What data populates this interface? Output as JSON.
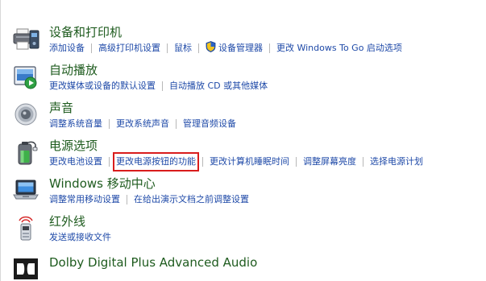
{
  "categories": [
    {
      "title": "设备和打印机",
      "icon": "printer-device-icon",
      "links": [
        "添加设备",
        "高级打印机设置",
        "鼠标",
        "设备管理器",
        "更改 Windows To Go 启动选项"
      ]
    },
    {
      "title": "自动播放",
      "icon": "autoplay-icon",
      "links": [
        "更改媒体或设备的默认设置",
        "自动播放 CD 或其他媒体"
      ]
    },
    {
      "title": "声音",
      "icon": "speaker-icon",
      "links": [
        "调整系统音量",
        "更改系统声音",
        "管理音频设备"
      ]
    },
    {
      "title": "电源选项",
      "icon": "battery-icon",
      "links": [
        "更改电池设置",
        "更改电源按钮的功能",
        "更改计算机睡眠时间",
        "调整屏幕亮度",
        "选择电源计划"
      ]
    },
    {
      "title": "Windows 移动中心",
      "icon": "mobility-center-icon",
      "links": [
        "调整常用移动设置",
        "在给出演示文档之前调整设置"
      ]
    },
    {
      "title": "红外线",
      "icon": "infrared-icon",
      "links": [
        "发送或接收文件"
      ]
    },
    {
      "title": "Dolby Digital Plus Advanced Audio",
      "icon": "dolby-icon",
      "links": []
    }
  ],
  "highlighted_link": "更改电源按钮的功能",
  "colors": {
    "title": "#1e5b1e",
    "link": "#1f4aa8",
    "highlight_box": "#d91c1c",
    "separator": "#b8b8b8"
  }
}
